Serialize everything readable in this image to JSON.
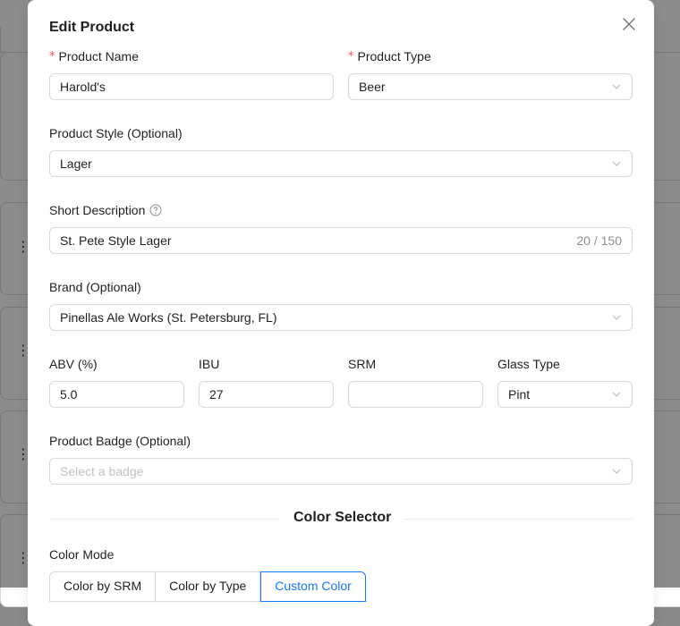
{
  "modal": {
    "title": "Edit Product",
    "close_icon": "close-icon"
  },
  "form": {
    "product_name": {
      "label": "Product Name",
      "required": true,
      "value": "Harold's"
    },
    "product_type": {
      "label": "Product Type",
      "required": true,
      "value": "Beer"
    },
    "product_style": {
      "label": "Product Style (Optional)",
      "value": "Lager"
    },
    "short_description": {
      "label": "Short Description",
      "value": "St. Pete Style Lager",
      "count": "20 / 150",
      "help_icon": "question-circle-icon"
    },
    "brand": {
      "label": "Brand (Optional)",
      "value": "Pinellas Ale Works (St. Petersburg, FL)"
    },
    "abv": {
      "label": "ABV (%)",
      "value": "5.0"
    },
    "ibu": {
      "label": "IBU",
      "value": "27"
    },
    "srm": {
      "label": "SRM",
      "value": ""
    },
    "glass_type": {
      "label": "Glass Type",
      "value": "Pint"
    },
    "product_badge": {
      "label": "Product Badge (Optional)",
      "placeholder": "Select a badge"
    }
  },
  "color_selector": {
    "divider_title": "Color Selector",
    "mode_label": "Color Mode",
    "options": [
      "Color by SRM",
      "Color by Type",
      "Custom Color"
    ],
    "selected": "Custom Color"
  },
  "colors": {
    "accent": "#1677ff",
    "required": "#ff4d4f",
    "border": "#d9d9d9"
  }
}
